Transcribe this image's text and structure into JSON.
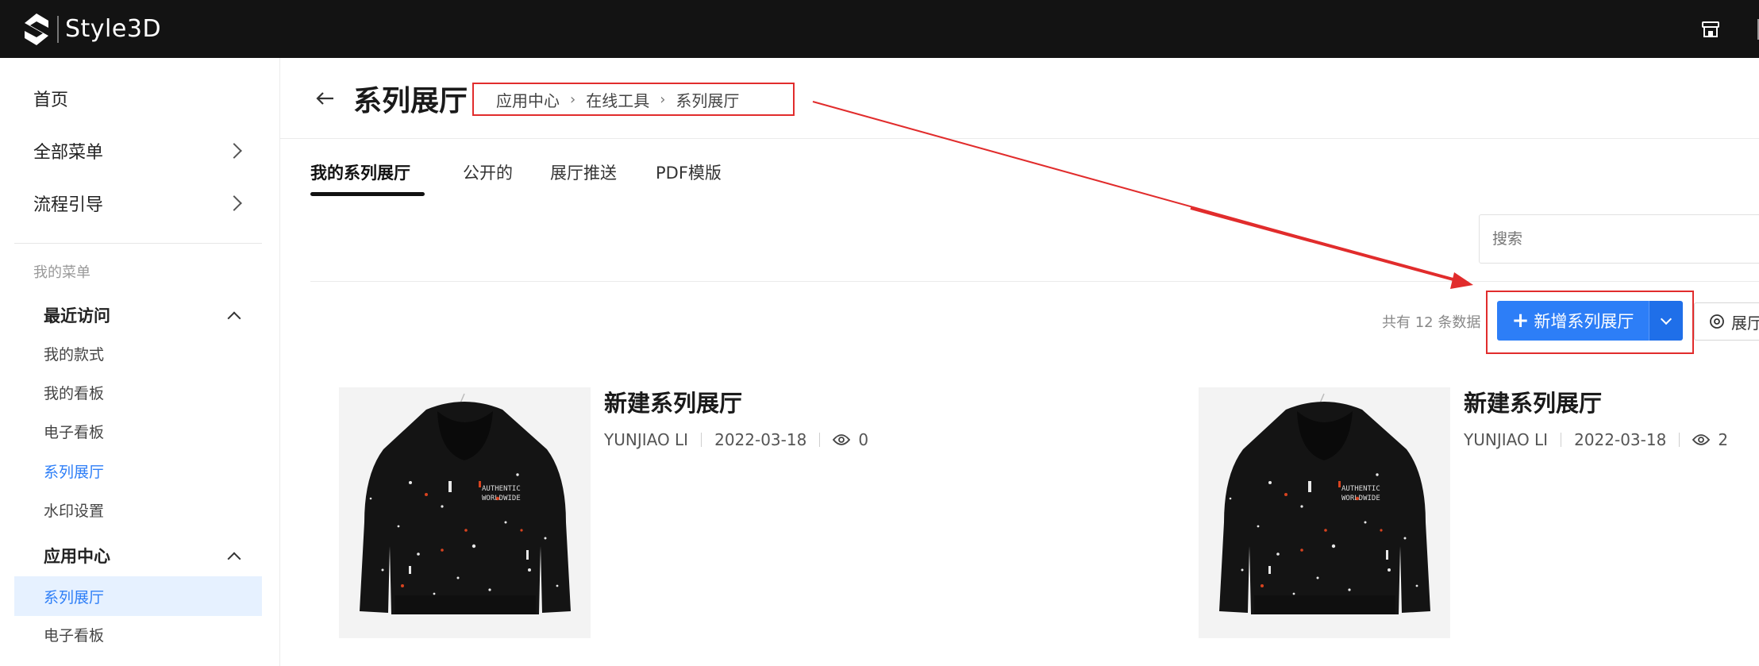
{
  "brand": {
    "name": "Style3D"
  },
  "sidebar": {
    "top_items": [
      {
        "label": "首页"
      },
      {
        "label": "全部菜单"
      },
      {
        "label": "流程引导"
      }
    ],
    "section_label": "我的菜单",
    "groups": [
      {
        "label": "最近访问",
        "items": [
          "我的款式",
          "我的看板",
          "电子看板",
          "系列展厅",
          "水印设置"
        ]
      },
      {
        "label": "应用中心",
        "items": [
          "系列展厅",
          "电子看板"
        ]
      }
    ]
  },
  "header": {
    "title": "系列展厅",
    "breadcrumb": [
      "应用中心",
      "在线工具",
      "系列展厅"
    ]
  },
  "tabs": [
    "我的系列展厅",
    "公开的",
    "展厅推送",
    "PDF模版"
  ],
  "search": {
    "placeholder": "搜索"
  },
  "toolbar": {
    "total": "共有 12 条数据",
    "new_button": "新增系列展厅",
    "secondary_button": "展厅"
  },
  "cards": [
    {
      "title": "新建系列展厅",
      "author": "YUNJIAO  LI",
      "date": "2022-03-18",
      "views": "0"
    },
    {
      "title": "新建系列展厅",
      "author": "YUNJIAO  LI",
      "date": "2022-03-18",
      "views": "2"
    }
  ],
  "colors": {
    "topbar": "#131313",
    "accent": "#2d7ef7",
    "annotation": "#e12c2c",
    "active_bg": "#e6f1ff"
  }
}
